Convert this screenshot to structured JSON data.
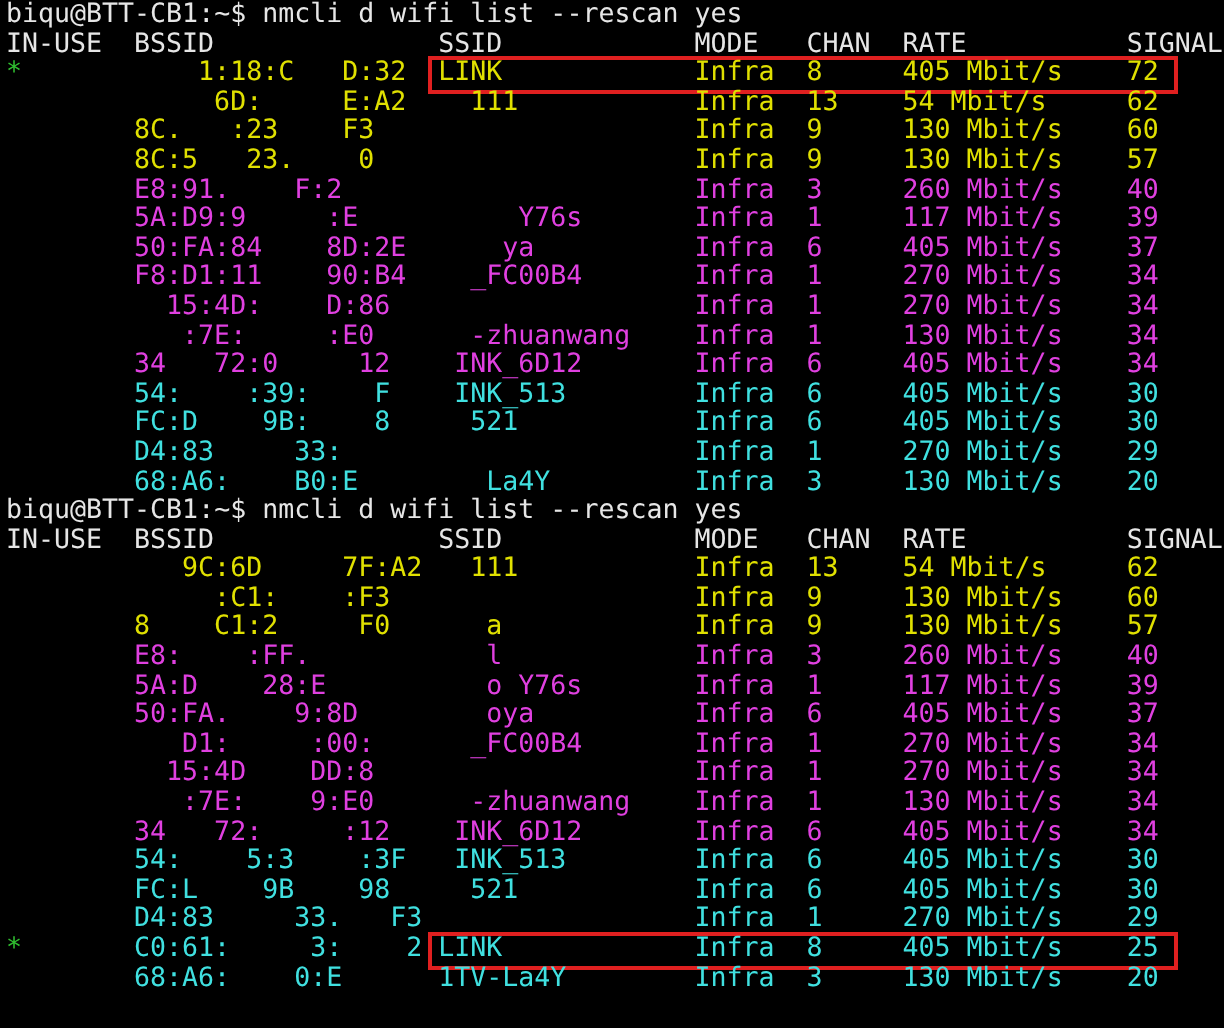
{
  "scans": [
    {
      "prompt": "biqu@BTT-CB1:~$ nmcli d wifi list --rescan yes",
      "columns": [
        "IN-USE",
        "BSSID",
        "SSID",
        "MODE",
        "CHAN",
        "RATE",
        "SIGNAL"
      ],
      "rows": [
        {
          "in_use": "*",
          "bssid": "    1:18:C   D:32",
          "ssid": "LINK",
          "mode": "Infra",
          "chan": "8",
          "rate": "405 Mbit/s",
          "signal": "72",
          "color": "#e0e000",
          "highlighted": true
        },
        {
          "bssid": "     6D:     E:A2",
          "ssid": "  111",
          "mode": "Infra",
          "chan": "13",
          "rate": "54 Mbit/s",
          "signal": "62",
          "color": "#e0e000",
          "highlighted": false
        },
        {
          "bssid": "8C.   :23    F3",
          "mode": "Infra",
          "chan": "9",
          "rate": "130 Mbit/s",
          "signal": "60",
          "color": "#e0e000",
          "highlighted": false
        },
        {
          "bssid": "8C:5   23.    0",
          "mode": "Infra",
          "chan": "9",
          "rate": "130 Mbit/s",
          "signal": "57",
          "color": "#e0e000",
          "highlighted": false
        },
        {
          "bssid": "E8:91.    F:2",
          "mode": "Infra",
          "chan": "3",
          "rate": "260 Mbit/s",
          "signal": "40",
          "color": "#e040e0",
          "highlighted": false
        },
        {
          "bssid": "5A:D9:9     :E",
          "ssid": "     Y76s",
          "mode": "Infra",
          "chan": "1",
          "rate": "117 Mbit/s",
          "signal": "39",
          "color": "#e040e0",
          "highlighted": false
        },
        {
          "bssid": "50:FA:84    8D:2E",
          "ssid": "    ya",
          "mode": "Infra",
          "chan": "6",
          "rate": "405 Mbit/s",
          "signal": "37",
          "color": "#e040e0",
          "highlighted": false
        },
        {
          "bssid": "F8:D1:11    90:B4",
          "ssid": "  _FC00B4",
          "mode": "Infra",
          "chan": "1",
          "rate": "270 Mbit/s",
          "signal": "34",
          "color": "#e040e0",
          "highlighted": false
        },
        {
          "bssid": "  15:4D:    D:86",
          "mode": "Infra",
          "chan": "1",
          "rate": "270 Mbit/s",
          "signal": "34",
          "color": "#e040e0",
          "highlighted": false
        },
        {
          "bssid": "   :7E:     :E0",
          "ssid": "  -zhuanwang",
          "mode": "Infra",
          "chan": "1",
          "rate": "130 Mbit/s",
          "signal": "34",
          "color": "#e040e0",
          "highlighted": false
        },
        {
          "bssid": "34   72:0     12",
          "ssid": " INK_6D12",
          "mode": "Infra",
          "chan": "6",
          "rate": "405 Mbit/s",
          "signal": "34",
          "color": "#e040e0",
          "highlighted": false
        },
        {
          "bssid": "54:    :39:    F",
          "ssid": " INK_513",
          "mode": "Infra",
          "chan": "6",
          "rate": "405 Mbit/s",
          "signal": "30",
          "color": "#40e0e0",
          "highlighted": false
        },
        {
          "bssid": "FC:D    9B:    8",
          "ssid": "  521",
          "mode": "Infra",
          "chan": "6",
          "rate": "405 Mbit/s",
          "signal": "30",
          "color": "#40e0e0",
          "highlighted": false
        },
        {
          "bssid": "D4:83     33:",
          "mode": "Infra",
          "chan": "1",
          "rate": "270 Mbit/s",
          "signal": "29",
          "color": "#40e0e0",
          "highlighted": false
        },
        {
          "bssid": "68:A6:    B0:E",
          "ssid": "   La4Y",
          "mode": "Infra",
          "chan": "3",
          "rate": "130 Mbit/s",
          "signal": "20",
          "color": "#40e0e0",
          "highlighted": false
        }
      ]
    },
    {
      "prompt": "biqu@BTT-CB1:~$ nmcli d wifi list --rescan yes",
      "columns": [
        "IN-USE",
        "BSSID",
        "SSID",
        "MODE",
        "CHAN",
        "RATE",
        "SIGNAL"
      ],
      "rows": [
        {
          "bssid": "   9C:6D     7F:A2",
          "ssid": "  111",
          "mode": "Infra",
          "chan": "13",
          "rate": "54 Mbit/s",
          "signal": "62",
          "color": "#e0e000",
          "highlighted": false
        },
        {
          "bssid": "     :C1:    :F3",
          "mode": "Infra",
          "chan": "9",
          "rate": "130 Mbit/s",
          "signal": "60",
          "color": "#e0e000",
          "highlighted": false
        },
        {
          "bssid": "8    C1:2     F0",
          "ssid": "   a",
          "mode": "Infra",
          "chan": "9",
          "rate": "130 Mbit/s",
          "signal": "57",
          "color": "#e0e000",
          "highlighted": false
        },
        {
          "bssid": "E8:    :FF.",
          "ssid": "   l",
          "mode": "Infra",
          "chan": "3",
          "rate": "260 Mbit/s",
          "signal": "40",
          "color": "#e040e0",
          "highlighted": false
        },
        {
          "bssid": "5A:D    28:E",
          "ssid": "   o Y76s",
          "mode": "Infra",
          "chan": "1",
          "rate": "117 Mbit/s",
          "signal": "39",
          "color": "#e040e0",
          "highlighted": false
        },
        {
          "bssid": "50:FA.    9:8D",
          "ssid": "   oya",
          "mode": "Infra",
          "chan": "6",
          "rate": "405 Mbit/s",
          "signal": "37",
          "color": "#e040e0",
          "highlighted": false
        },
        {
          "bssid": "   D1:     :00:",
          "ssid": "  _FC00B4",
          "mode": "Infra",
          "chan": "1",
          "rate": "270 Mbit/s",
          "signal": "34",
          "color": "#e040e0",
          "highlighted": false
        },
        {
          "bssid": "  15:4D    DD:8",
          "mode": "Infra",
          "chan": "1",
          "rate": "270 Mbit/s",
          "signal": "34",
          "color": "#e040e0",
          "highlighted": false
        },
        {
          "bssid": "   :7E:    9:E0",
          "ssid": "  -zhuanwang",
          "mode": "Infra",
          "chan": "1",
          "rate": "130 Mbit/s",
          "signal": "34",
          "color": "#e040e0",
          "highlighted": false
        },
        {
          "bssid": "34   72:     :12",
          "ssid": " INK_6D12",
          "mode": "Infra",
          "chan": "6",
          "rate": "405 Mbit/s",
          "signal": "34",
          "color": "#e040e0",
          "highlighted": false
        },
        {
          "bssid": "54:    5:3    :3F",
          "ssid": " INK_513",
          "mode": "Infra",
          "chan": "6",
          "rate": "405 Mbit/s",
          "signal": "30",
          "color": "#40e0e0",
          "highlighted": false
        },
        {
          "bssid": "FC:L    9B    98",
          "ssid": "  521",
          "mode": "Infra",
          "chan": "6",
          "rate": "405 Mbit/s",
          "signal": "30",
          "color": "#40e0e0",
          "highlighted": false
        },
        {
          "bssid": "D4:83     33.   F3",
          "mode": "Infra",
          "chan": "1",
          "rate": "270 Mbit/s",
          "signal": "29",
          "color": "#40e0e0",
          "highlighted": false
        },
        {
          "in_use": "*",
          "bssid": "C0:61:     3:    2",
          "ssid": "LINK",
          "mode": "Infra",
          "chan": "8",
          "rate": "405 Mbit/s",
          "signal": "25",
          "color": "#40e0e0",
          "highlighted": true
        },
        {
          "bssid": "68:A6:    0:E",
          "ssid": "1TV-La4Y",
          "mode": "Infra",
          "chan": "3",
          "rate": "130 Mbit/s",
          "signal": "20",
          "color": "#40e0e0",
          "highlighted": false
        }
      ]
    }
  ]
}
